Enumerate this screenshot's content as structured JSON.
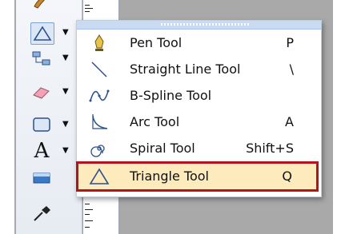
{
  "palette": {
    "tools": [
      {
        "icon": "brush-icon"
      },
      {
        "icon": "triangle-icon"
      },
      {
        "icon": "connector-icon"
      },
      {
        "icon": "eraser-icon"
      },
      {
        "icon": "rectangle-icon"
      },
      {
        "icon": "text-icon",
        "glyph": "A"
      },
      {
        "icon": "color-swatch-icon"
      },
      {
        "icon": "eyedropper-icon"
      }
    ]
  },
  "menu": {
    "items": [
      {
        "label": "Pen Tool",
        "shortcut": "P",
        "icon": "pen-icon"
      },
      {
        "label": "Straight Line Tool",
        "shortcut": "\\",
        "icon": "straight-line-icon"
      },
      {
        "label": "B-Spline Tool",
        "shortcut": "",
        "icon": "bspline-icon"
      },
      {
        "label": "Arc Tool",
        "shortcut": "A",
        "icon": "arc-icon"
      },
      {
        "label": "Spiral Tool",
        "shortcut": "Shift+S",
        "icon": "spiral-icon"
      },
      {
        "label": "Triangle Tool",
        "shortcut": "Q",
        "icon": "triangle-icon",
        "selected": true
      }
    ]
  },
  "colors": {
    "selection_highlight": "#fdebbd",
    "selection_border": "#b3131a",
    "menu_grip": "#c9dbf3"
  }
}
